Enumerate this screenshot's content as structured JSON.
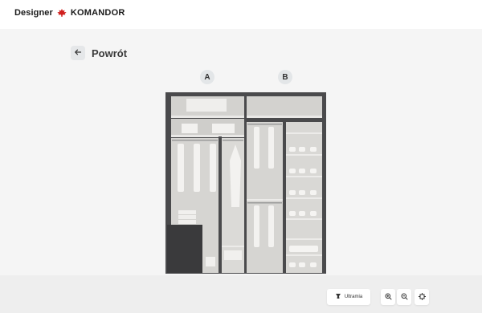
{
  "header": {
    "brand_prefix": "Designer",
    "brand_name": "KOMANDOR",
    "brand_icon": "maple-leaf-icon"
  },
  "nav": {
    "back_label": "Powrót",
    "back_icon": "arrow-left-icon"
  },
  "wardrobe": {
    "sections": [
      "A",
      "B"
    ]
  },
  "toolbar": {
    "frame_label": "Ultramia",
    "frame_icon": "frame-icon",
    "zoom_in_icon": "zoom-in-icon",
    "zoom_out_icon": "zoom-out-icon",
    "fit_icon": "fit-view-icon"
  },
  "colors": {
    "brand_red": "#d0201e",
    "frame_dark": "#4a4a4c",
    "interior": "#d9d8d5",
    "shelf": "#e9e8e6",
    "badge_bg": "#e3e6e8",
    "bottom_bar": "#eeeeee"
  }
}
